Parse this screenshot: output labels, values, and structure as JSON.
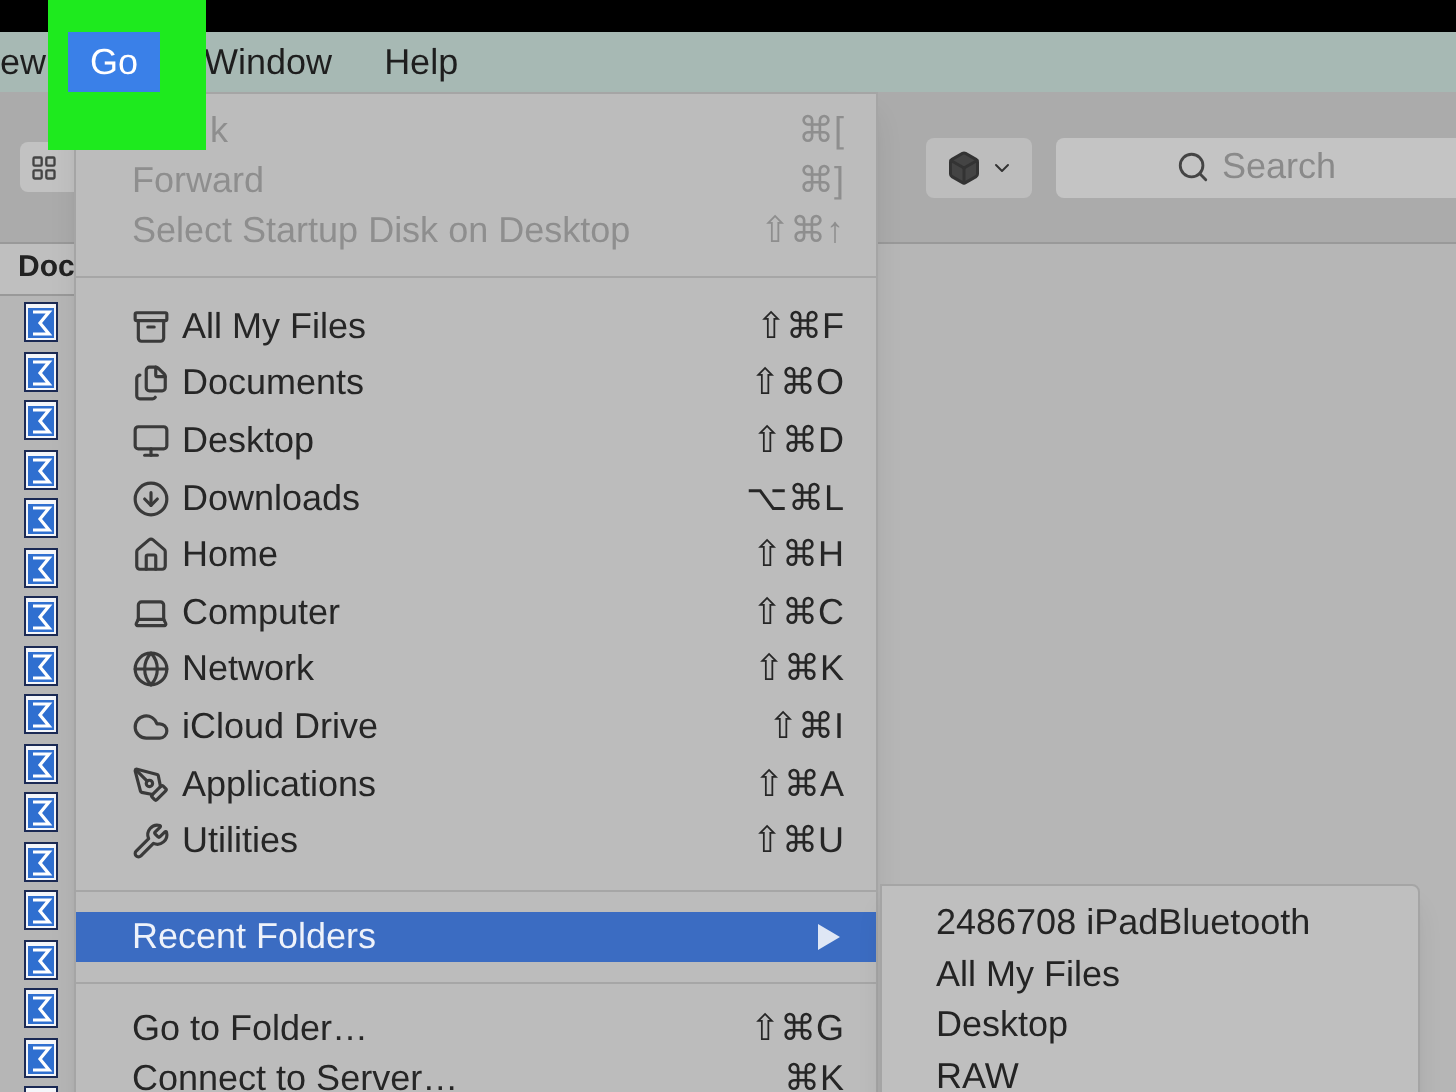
{
  "menu_bar": [
    {
      "label": "ew",
      "selected": false
    },
    {
      "label": "Go",
      "selected": true
    },
    {
      "label": "Window",
      "selected": false
    },
    {
      "label": "Help",
      "selected": false
    }
  ],
  "toolbar": {
    "search": {
      "placeholder": "Search"
    }
  },
  "file_column": {
    "header": "Doc"
  },
  "go_menu": {
    "sections": [
      [
        {
          "kind": "covered",
          "label": "k",
          "shortcut": "⌘[",
          "disabled": true,
          "selected": false,
          "submenu": false
        },
        {
          "kind": "plain",
          "label": "Forward",
          "shortcut": "⌘]",
          "disabled": true,
          "selected": false,
          "submenu": false
        },
        {
          "kind": "plain",
          "label": "Select Startup Disk on Desktop",
          "shortcut": "⇧⌘↑",
          "disabled": true,
          "selected": false,
          "submenu": false
        }
      ],
      [
        {
          "kind": "place",
          "label": "All My Files",
          "shortcut": "⇧⌘F",
          "disabled": false,
          "selected": false,
          "submenu": false
        },
        {
          "kind": "place",
          "label": "Documents",
          "shortcut": "⇧⌘O",
          "disabled": false,
          "selected": false,
          "submenu": false
        },
        {
          "kind": "place",
          "label": "Desktop",
          "shortcut": "⇧⌘D",
          "disabled": false,
          "selected": false,
          "submenu": false
        },
        {
          "kind": "place",
          "label": "Downloads",
          "shortcut": "⌥⌘L",
          "disabled": false,
          "selected": false,
          "submenu": false
        },
        {
          "kind": "place",
          "label": "Home",
          "shortcut": "⇧⌘H",
          "disabled": false,
          "selected": false,
          "submenu": false
        },
        {
          "kind": "place",
          "label": "Computer",
          "shortcut": "⇧⌘C",
          "disabled": false,
          "selected": false,
          "submenu": false
        },
        {
          "kind": "place",
          "label": "Network",
          "shortcut": "⇧⌘K",
          "disabled": false,
          "selected": false,
          "submenu": false
        },
        {
          "kind": "place",
          "label": "iCloud Drive",
          "shortcut": "⇧⌘I",
          "disabled": false,
          "selected": false,
          "submenu": false
        },
        {
          "kind": "place",
          "label": "Applications",
          "shortcut": "⇧⌘A",
          "disabled": false,
          "selected": false,
          "submenu": false
        },
        {
          "kind": "place",
          "label": "Utilities",
          "shortcut": "⇧⌘U",
          "disabled": false,
          "selected": false,
          "submenu": false
        }
      ],
      [
        {
          "kind": "plain",
          "label": "Recent Folders",
          "disabled": false,
          "selected": true,
          "submenu": true
        }
      ],
      [
        {
          "kind": "plain",
          "label": "Go to Folder…",
          "shortcut": "⇧⌘G",
          "disabled": false,
          "selected": false,
          "submenu": false
        },
        {
          "kind": "plain",
          "label": "Connect to Server…",
          "shortcut": "⌘K",
          "disabled": false,
          "selected": false,
          "submenu": false
        }
      ]
    ]
  },
  "recent_folders_submenu": [
    {
      "label": "2486708 iPadBluetooth"
    },
    {
      "label": "All My Files"
    },
    {
      "label": "Desktop"
    },
    {
      "label": "RAW"
    }
  ]
}
